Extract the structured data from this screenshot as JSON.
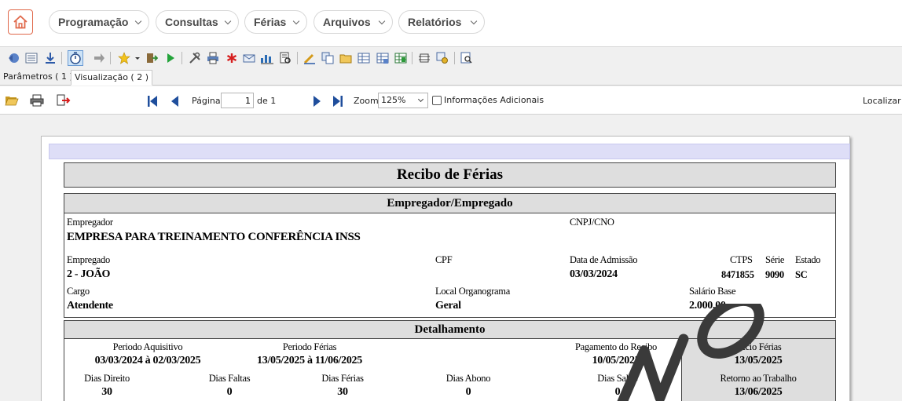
{
  "nav": {
    "menus": [
      "Programação",
      "Consultas",
      "Férias",
      "Arquivos",
      "Relatórios"
    ]
  },
  "toolbar": {
    "icons": [
      "back-icon",
      "list-icon",
      "download-icon",
      "stopwatch-icon",
      "forward-icon",
      "star-icon",
      "dropdown-icon",
      "exit-icon",
      "play-icon",
      "tools-icon",
      "printer-icon",
      "asterisk-icon",
      "mail-icon",
      "chart-icon",
      "report-icon",
      "edit-icon",
      "copy-icon",
      "folder-icon",
      "table-icon",
      "table-export-icon",
      "spreadsheet-icon",
      "layout-icon",
      "settings-icon",
      "preview-icon"
    ]
  },
  "tabs": [
    {
      "label": "Parâmetros ( 1 )",
      "active": false
    },
    {
      "label": "Visualização ( 2 )",
      "active": true
    }
  ],
  "viewer_bar": {
    "page_label": "Página",
    "page_value": "1",
    "page_of": "de 1",
    "zoom_label": "Zoom",
    "zoom_value": "125%",
    "extra_info_label": "Informações Adicionais",
    "find_label": "Localizar"
  },
  "report": {
    "title": "Recibo de Férias",
    "section_employer": "Empregador/Empregado",
    "employer_label": "Empregador",
    "employer_value": "EMPRESA PARA TREINAMENTO CONFERÊNCIA INSS",
    "cnpj_label": "CNPJ/CNO",
    "employee_label": "Empregado",
    "employee_value": "2 - JOÃO",
    "cpf_label": "CPF",
    "admission_label": "Data de Admissão",
    "admission_value": "03/03/2024",
    "ctps_label": "CTPS",
    "ctps_value": "8471855",
    "serie_label": "Série",
    "serie_value": "9090",
    "estado_label": "Estado",
    "estado_value": "SC",
    "cargo_label": "Cargo",
    "cargo_value": "Atendente",
    "local_label": "Local Organograma",
    "local_value": "Geral",
    "salario_label": "Salário Base",
    "salario_value": "2.000,00",
    "section_detail": "Detalhamento",
    "periodo_aquisitivo_label": "Periodo Aquisitivo",
    "periodo_aquisitivo_value": "03/03/2024 à 02/03/2025",
    "periodo_ferias_label": "Periodo Férias",
    "periodo_ferias_value": "13/05/2025 à 11/06/2025",
    "pagamento_label": "Pagamento do Recibo",
    "pagamento_value": "10/05/2025",
    "inicio_label": "Inicio Férias",
    "inicio_value": "13/05/2025",
    "dias_direito_label": "Dias Direito",
    "dias_direito_value": "30",
    "dias_faltas_label": "Dias Faltas",
    "dias_faltas_value": "0",
    "dias_ferias_label": "Dias Férias",
    "dias_ferias_value": "30",
    "dias_abono_label": "Dias Abono",
    "dias_abono_value": "0",
    "dias_saldo_label": "Dias Saldo",
    "dias_saldo_value": "0",
    "retorno_label": "Retorno ao Trabalho",
    "retorno_value": "13/06/2025"
  },
  "colors": {
    "accent": "#e0684a",
    "header_fill": "#dedede",
    "page_strip": "#dedef7"
  }
}
